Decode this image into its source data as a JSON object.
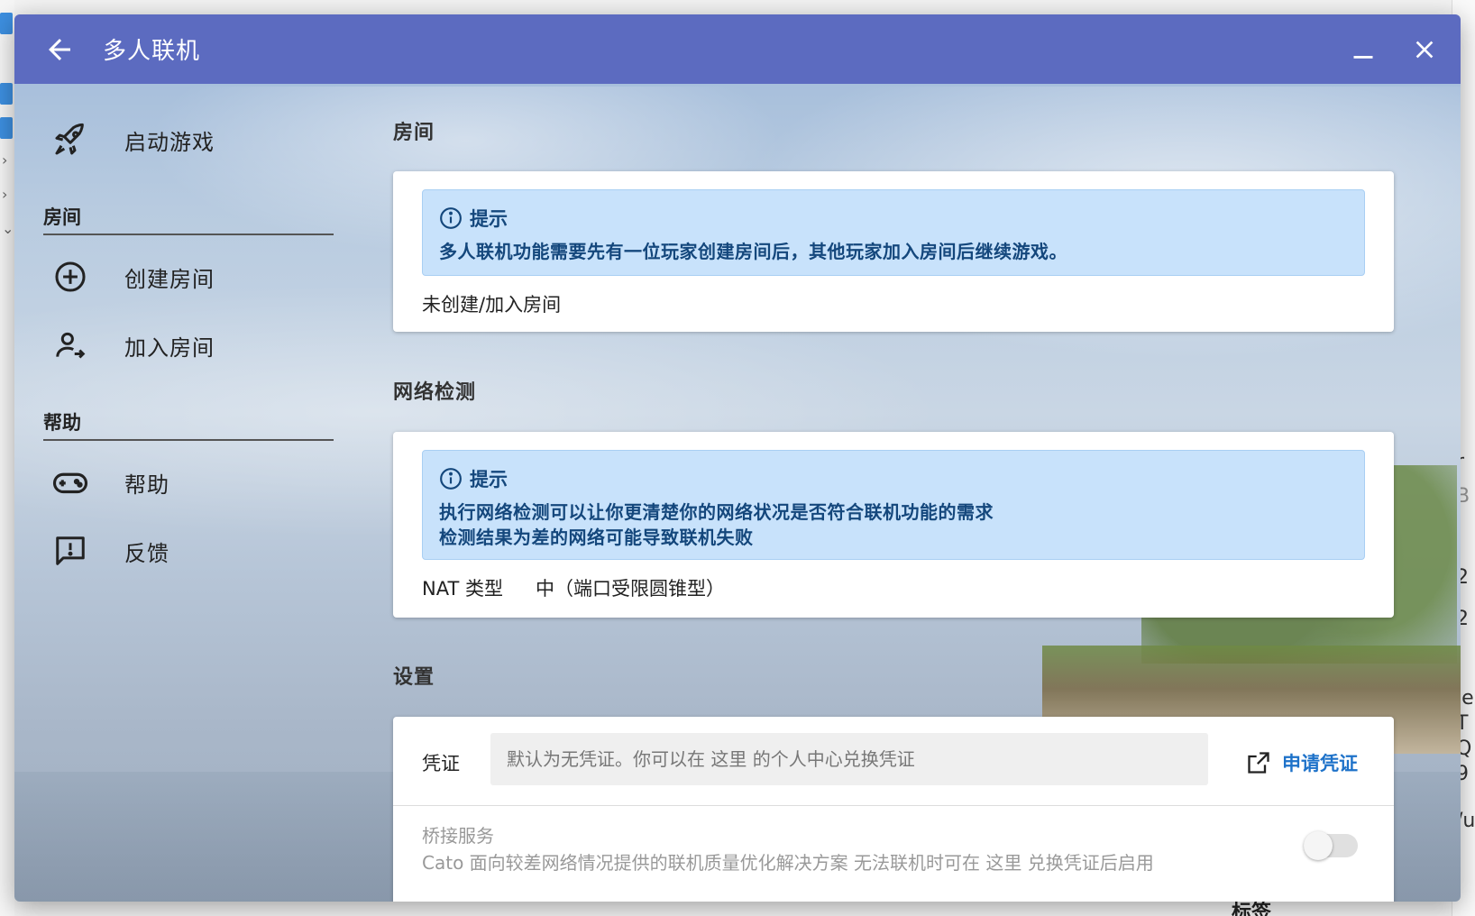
{
  "window": {
    "title": "多人联机",
    "titlebar_color": "#5c6bc0"
  },
  "sidebar": {
    "launch": {
      "label": "启动游戏",
      "icon": "rocket-icon"
    },
    "room_header": "房间",
    "create_room": {
      "label": "创建房间",
      "icon": "add-circle-icon"
    },
    "join_room": {
      "label": "加入房间",
      "icon": "person-join-icon"
    },
    "help_header": "帮助",
    "help": {
      "label": "帮助",
      "icon": "gamepad-icon"
    },
    "feedback": {
      "label": "反馈",
      "icon": "feedback-icon"
    }
  },
  "room": {
    "title": "房间",
    "hint_title": "提示",
    "hint_body": "多人联机功能需要先有一位玩家创建房间后，其他玩家加入房间后继续游戏。",
    "status": "未创建/加入房间"
  },
  "network": {
    "title": "网络检测",
    "hint_title": "提示",
    "hint_line1": "执行网络检测可以让你更清楚你的网络状况是否符合联机功能的需求",
    "hint_line2": "检测结果为差的网络可能导致联机失败",
    "nat_label": "NAT 类型",
    "nat_value": "中（端口受限圆锥型）"
  },
  "settings": {
    "title": "设置",
    "credential_label": "凭证",
    "credential_placeholder": "默认为无凭证。你可以在 这里 的个人中心兑换凭证",
    "credential_value": "",
    "apply_label": "申请凭证",
    "bridge_title": "桥接服务",
    "bridge_desc": "Cato 面向较差网络情况提供的联机质量优化解决方案 无法联机时可在 这里 兑换凭证后启用",
    "bridge_enabled": false
  },
  "accent_color": "#1e72c9",
  "hint_color": "#c8e2fb",
  "background_right_fragments": [
    "r",
    "B",
    "2",
    "2",
    "le",
    "T",
    "Q",
    "9",
    "/u"
  ],
  "background_bottom_label": "标签"
}
